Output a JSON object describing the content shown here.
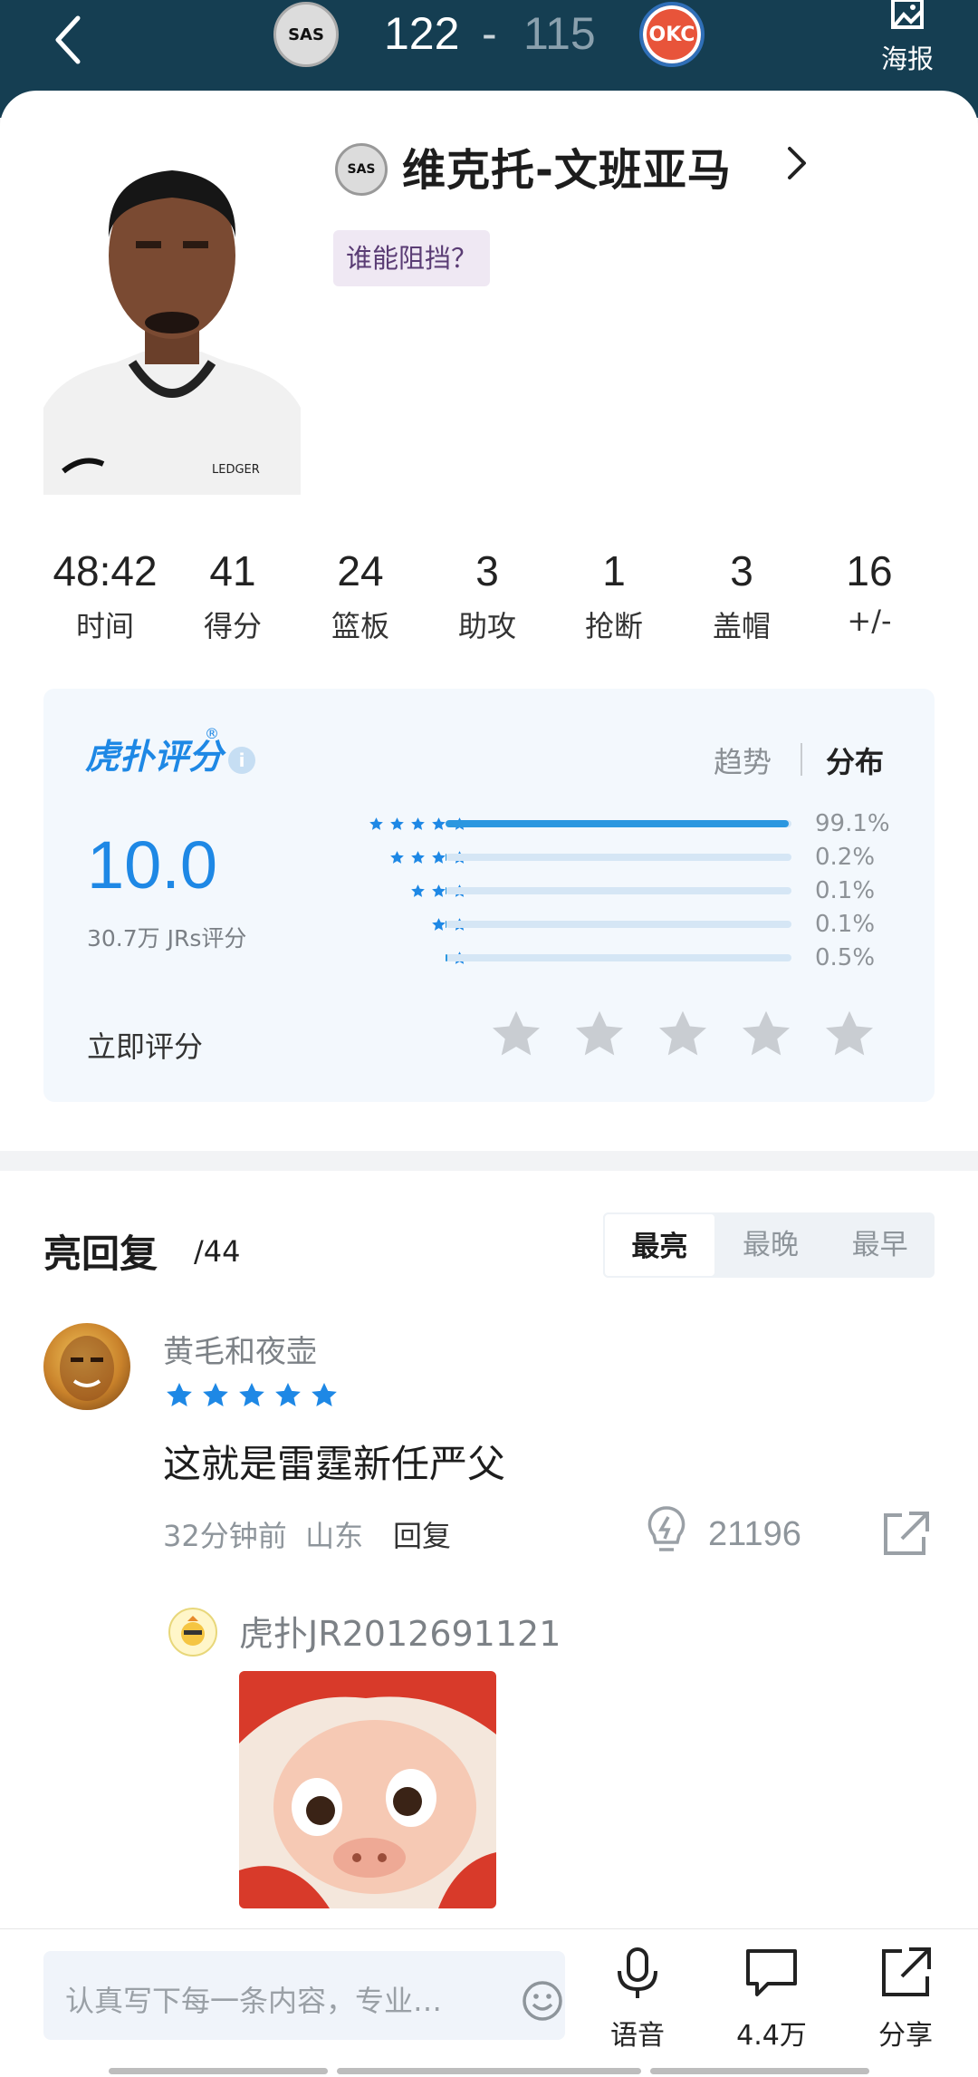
{
  "header": {
    "home_team_abbr": "SAS",
    "away_team_abbr": "OKC",
    "home_score": "122",
    "score_separator": "-",
    "away_score": "115",
    "poster_label": "海报"
  },
  "player": {
    "team_abbr": "SAS",
    "name": "维克托-文班亚马",
    "tag": "谁能阻挡？",
    "jersey_text": "LEDGER"
  },
  "stats": [
    {
      "value": "48:42",
      "label": "时间"
    },
    {
      "value": "41",
      "label": "得分"
    },
    {
      "value": "24",
      "label": "篮板"
    },
    {
      "value": "3",
      "label": "助攻"
    },
    {
      "value": "1",
      "label": "抢断"
    },
    {
      "value": "3",
      "label": "盖帽"
    },
    {
      "value": "16",
      "label": "+/-"
    }
  ],
  "rating": {
    "brand": "虎扑评分",
    "brand_mark": "®",
    "info_icon": "i",
    "tab_trend": "趋势",
    "tab_distribution": "分布",
    "score": "10.0",
    "count_text": "30.7万 JRs评分",
    "distribution": [
      {
        "stars": 5,
        "percent": 99.1,
        "label": "99.1%"
      },
      {
        "stars": 4,
        "percent": 0.2,
        "label": "0.2%"
      },
      {
        "stars": 3,
        "percent": 0.1,
        "label": "0.1%"
      },
      {
        "stars": 2,
        "percent": 0.1,
        "label": "0.1%"
      },
      {
        "stars": 1,
        "percent": 0.5,
        "label": "0.5%"
      }
    ],
    "rate_now_label": "立即评分",
    "colors": {
      "accent": "#1e88e5",
      "track": "#d5e6f5",
      "star_gray": "#c9cdd2"
    }
  },
  "comments": {
    "title": "亮回复",
    "count": "/44",
    "sort_tabs": [
      "最亮",
      "最晚",
      "最早"
    ],
    "active_sort": 0,
    "items": [
      {
        "user": "黄毛和夜壶",
        "rating": 5,
        "text": "这就是雷霆新任严父",
        "time": "32分钟前",
        "location": "山东",
        "reply_label": "回复",
        "lights": "21196",
        "reply": {
          "user": "虎扑JR2012691121"
        }
      }
    ]
  },
  "bottom_bar": {
    "input_placeholder": "认真写下每一条内容，专业…",
    "voice_label": "语音",
    "comments_label": "4.4万",
    "share_label": "分享"
  }
}
